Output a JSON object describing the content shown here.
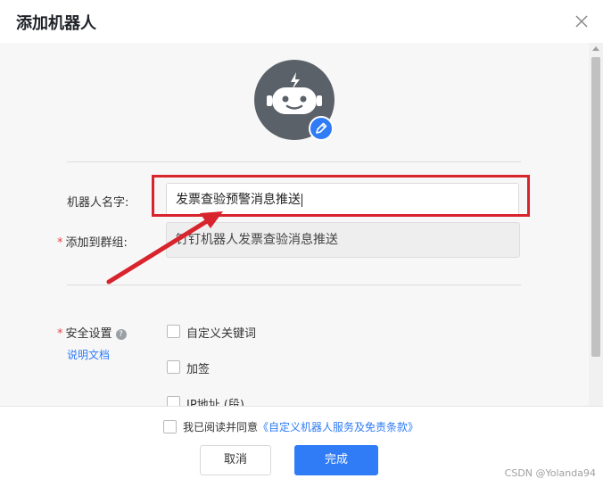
{
  "dialog": {
    "title": "添加机器人"
  },
  "form": {
    "name_label": "机器人名字:",
    "name_value": "发票查验预警消息推送",
    "group_label": "添加到群组:",
    "group_value": "钉钉机器人发票查验消息推送",
    "security_label": "安全设置",
    "help_doc_link": "说明文档",
    "security_options": [
      {
        "label": "自定义关键词",
        "checked": false
      },
      {
        "label": "加签",
        "checked": false
      },
      {
        "label": "IP地址 (段)",
        "checked": false
      }
    ]
  },
  "footer": {
    "agree_prefix": "我已阅读并同意",
    "agree_link": "《自定义机器人服务及免责条款》",
    "cancel_label": "取消",
    "done_label": "完成",
    "watermark": "CSDN @Yolanda94"
  },
  "colors": {
    "primary": "#2f7cf6",
    "highlight_box": "#d8242c",
    "avatar_bg": "#5b6169"
  }
}
